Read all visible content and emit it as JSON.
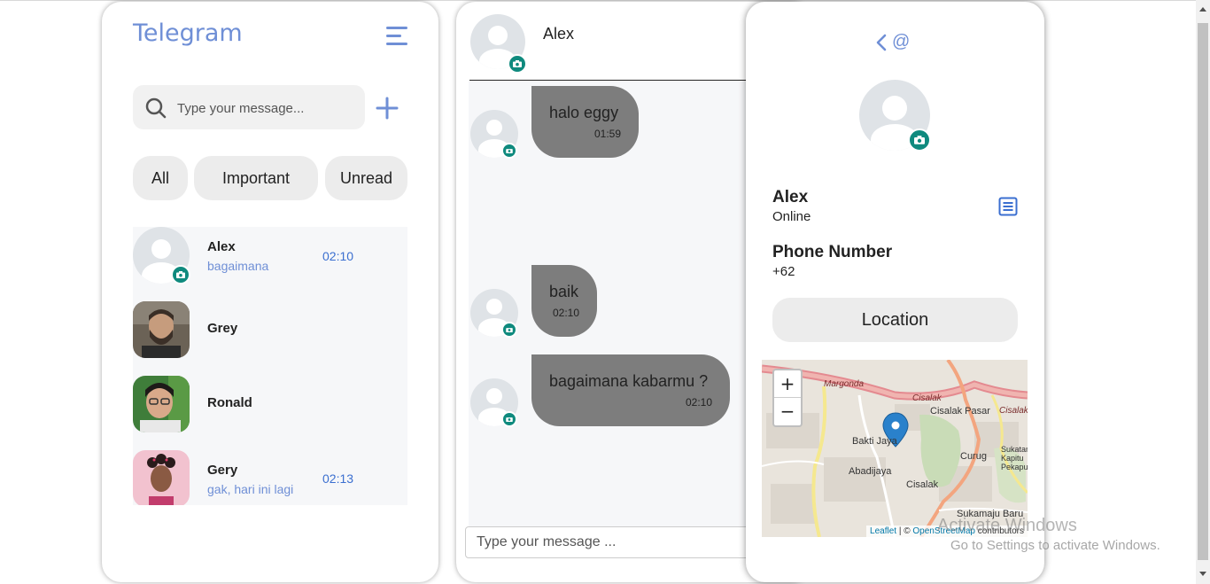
{
  "left_panel": {
    "app_title": "Telegram",
    "search_placeholder": "Type your message...",
    "filters": [
      "All",
      "Important",
      "Unread"
    ],
    "chats": [
      {
        "name": "Alex",
        "last_message": "bagaimana",
        "time": "02:10",
        "avatar": "default-avatar"
      },
      {
        "name": "Grey",
        "last_message": "",
        "time": "",
        "avatar": "photo-man-beard"
      },
      {
        "name": "Ronald",
        "last_message": "",
        "time": "",
        "avatar": "photo-man-glasses"
      },
      {
        "name": "Gery",
        "last_message": "gak, hari ini lagi",
        "time": "02:13",
        "avatar": "photo-woman-pink"
      }
    ]
  },
  "chat_panel": {
    "contact_name": "Alex",
    "messages": [
      {
        "text": "halo eggy",
        "time": "01:59"
      },
      {
        "text": "baik",
        "time": "02:10"
      },
      {
        "text": "bagaimana kabarmu ?",
        "time": "02:10"
      }
    ],
    "input_placeholder": "Type your message ..."
  },
  "info_panel": {
    "back_label": "<",
    "at_label": "@",
    "name": "Alex",
    "status": "Online",
    "phone_title": "Phone Number",
    "phone_value": "+62",
    "location_button": "Location",
    "map": {
      "zoom_in": "+",
      "zoom_out": "−",
      "places": [
        "Margonda",
        "Cisalak",
        "Cisalak Pasar",
        "Bakti Jaya",
        "Abadijaya",
        "Cisalak",
        "Curug",
        "Sukatani Kapitu Pekapu",
        "Sukamaju Baru",
        "Cisalak"
      ],
      "attribution_leaflet": "Leaflet",
      "attribution_sep": " | © ",
      "attribution_osm": "OpenStreetMap",
      "attribution_tail": " contributors"
    }
  },
  "watermark": {
    "line1": "Activate Windows",
    "line2": "Go to Settings to activate Windows."
  },
  "colors": {
    "accent": "#6f8fd6",
    "time_blue": "#3b6fd0",
    "camera_badge": "#0f8a7e",
    "bubble": "#7d7d7d",
    "chip_bg": "#ececec"
  }
}
